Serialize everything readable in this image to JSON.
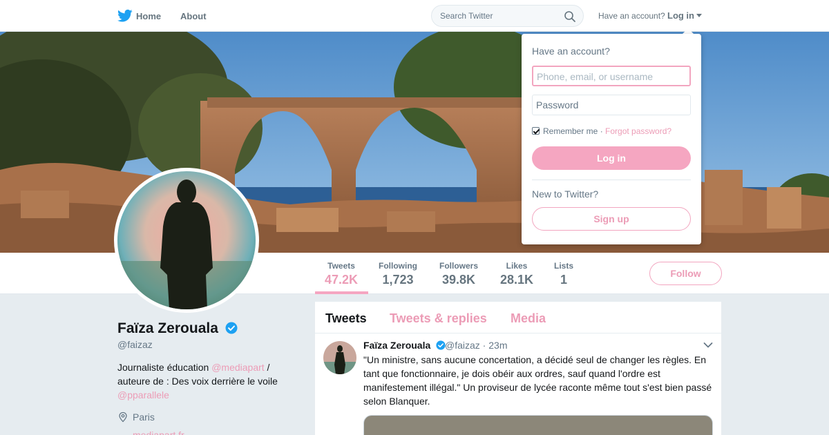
{
  "nav": {
    "home_label": "Home",
    "about_label": "About",
    "search_placeholder": "Search Twitter",
    "have_account": "Have an account?",
    "login_label": "Log in"
  },
  "stats": [
    {
      "label": "Tweets",
      "value": "47.2K"
    },
    {
      "label": "Following",
      "value": "1,723"
    },
    {
      "label": "Followers",
      "value": "39.8K"
    },
    {
      "label": "Likes",
      "value": "28.1K"
    },
    {
      "label": "Lists",
      "value": "1"
    }
  ],
  "follow_label": "Follow",
  "profile": {
    "name": "Faïza Zerouala",
    "handle": "@faizaz",
    "bio_part1": "Journaliste éducation ",
    "bio_link1": "@mediapart",
    "bio_part2": " / auteure de : Des voix derrière le voile ",
    "bio_link2": "@pparallele",
    "location": "Paris",
    "website": "mediapart.fr"
  },
  "timeline": {
    "tabs": [
      "Tweets",
      "Tweets & replies",
      "Media"
    ],
    "tweet": {
      "name": "Faïza Zerouala",
      "handle": "@faizaz",
      "time": "23m",
      "text": "\"Un ministre,  sans aucune concertation, a décidé seul de changer les règles. En tant  que fonctionnaire, je dois obéir aux ordres, sauf quand l'ordre est manifestement illégal.\" Un proviseur de lycée raconte même tout s'est bien passé selon Blanquer."
    }
  },
  "login_dropdown": {
    "title": "Have an account?",
    "username_placeholder": "Phone, email, or username",
    "password_placeholder": "Password",
    "remember_label": "Remember me",
    "separator": " · ",
    "forgot_label": "Forgot password?",
    "login_button": "Log in",
    "new_label": "New to Twitter?",
    "signup_button": "Sign up"
  },
  "colors": {
    "accent": "#ec9cb6",
    "verified": "#1da1f2",
    "twitter_blue": "#1da1f2"
  },
  "icons": [
    "twitter-bird-icon",
    "search-icon",
    "caret-down-icon",
    "verified-icon",
    "location-icon",
    "chevron-down-icon"
  ]
}
